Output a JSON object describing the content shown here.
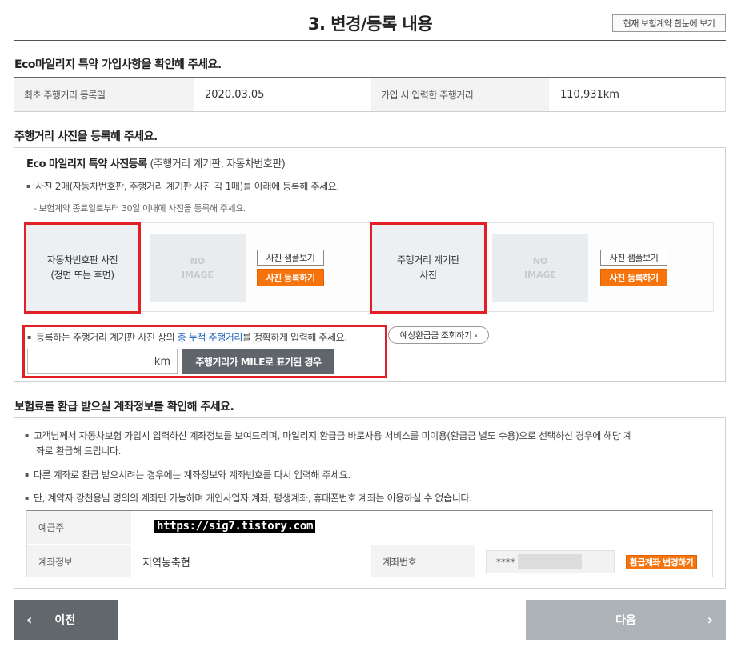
{
  "header": {
    "title": "3. 변경/등록 내용",
    "summary_button": "현재 보험계약 한눈에 보기"
  },
  "eco_info": {
    "heading": "Eco마일리지 특약 가입사항을 확인해 주세요.",
    "first_reg_label": "최초 주행거리 등록일",
    "first_reg_value": "2020.03.05",
    "entered_mileage_label": "가입 시 입력한 주행거리",
    "entered_mileage_value": "110,931km"
  },
  "photo": {
    "heading": "주행거리 사진을 등록해 주세요.",
    "subtitle": "Eco 마일리지 특약 사진등록",
    "subtitle_note": " (주행거리 계기판, 자동차번호판)",
    "bullet1": "사진 2매(자동차번호판, 주행거리 계기판 사진 각 1매)를 아래에 등록해 주세요.",
    "note": "보험계약 종료일로부터 30일 이내에 사진을 등록해 주세요.",
    "plate_label_line1": "자동차번호판 사진",
    "plate_label_line2": "(정면 또는 후면)",
    "odo_label_line1": "주행거리 계기판",
    "odo_label_line2": "사진",
    "noimg_line1": "NO",
    "noimg_line2": "IMAGE",
    "sample_button": "사진 샘플보기",
    "upload_button": "사진 등록하기",
    "mile_bullet_pre": "등록하는 주행거리 계기판 사진 상의 ",
    "mile_bullet_hl": "총 누적 주행거리",
    "mile_bullet_post": "를 정확하게 입력해 주세요.",
    "km_unit": "km",
    "mile_button": "주행거리가 MILE로 표기된 경우",
    "refund_button": "예상환급금 조회하기 ›"
  },
  "account": {
    "heading": "보험료를 환급 받으실 계좌정보를 확인해 주세요.",
    "bullet1a": "고객님께서 자동차보험 가입시 입력하신 계좌정보를 보여드리며, 마일리지 환급금 바로사용 서비스를 미이용(환급금 별도 수용)으로 선택하신 경우에 해당 계",
    "bullet1b": "좌로 환급해 드립니다.",
    "bullet2": "다른 계좌로 환급 받으시려는 경우에는 계좌정보와 계좌번호를 다시 입력해 주세요.",
    "bullet3": "단, 계약자 강천용님 명의의 계좌만 가능하며 개인사업자 계좌, 평생계좌, 휴대폰번호 계좌는 이용하실 수 없습니다.",
    "holder_label": "예금주",
    "watermark": "https://sig7.tistory.com",
    "bank_label": "계좌정보",
    "bank_value": "지역농축협",
    "number_label": "계좌번호",
    "number_masked": "****",
    "change_button": "환급계좌 변경하기"
  },
  "nav": {
    "prev": "이전",
    "next": "다음",
    "prev_icon": "‹",
    "next_icon": "›"
  },
  "colors": {
    "accent_orange": "#f7740d",
    "highlight_red": "#e21f26",
    "link_blue": "#1c62b9"
  }
}
